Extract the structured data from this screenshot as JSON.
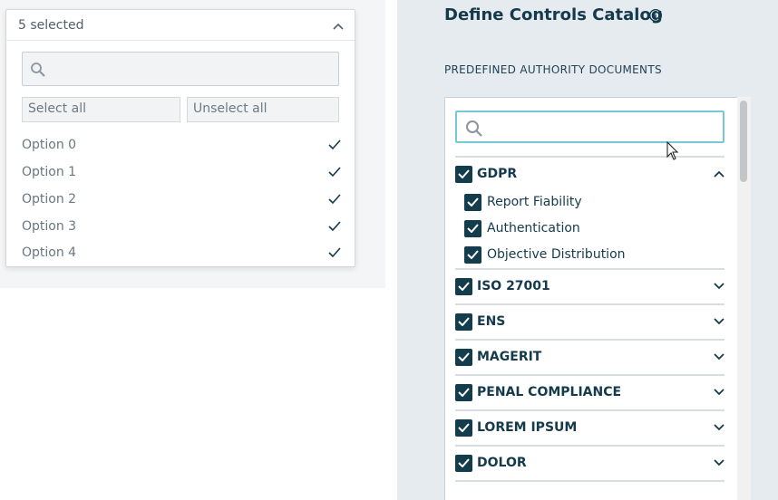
{
  "dropdown": {
    "selected_text": "5 selected",
    "search_placeholder": "",
    "select_all_label": "Select all",
    "unselect_all_label": "Unselect all",
    "options": [
      {
        "label": "Option 0",
        "checked": true
      },
      {
        "label": "Option 1",
        "checked": true
      },
      {
        "label": "Option 2",
        "checked": true
      },
      {
        "label": "Option 3",
        "checked": true
      },
      {
        "label": "Option 4",
        "checked": true
      }
    ]
  },
  "panel": {
    "title": "Define Controls Catalog",
    "section_label": "PREDEFINED AUTHORITY DOCUMENTS",
    "search_placeholder": "",
    "groups": [
      {
        "label": "GDPR",
        "checked": true,
        "expanded": true,
        "children": [
          {
            "label": "Report Fiability",
            "checked": true
          },
          {
            "label": "Authentication",
            "checked": true
          },
          {
            "label": "Objective Distribution",
            "checked": true
          }
        ]
      },
      {
        "label": "ISO 27001",
        "checked": true,
        "expanded": false
      },
      {
        "label": "ENS",
        "checked": true,
        "expanded": false
      },
      {
        "label": "MAGERIT",
        "checked": true,
        "expanded": false
      },
      {
        "label": "PENAL COMPLIANCE",
        "checked": true,
        "expanded": false
      },
      {
        "label": "LOREM IPSUM",
        "checked": true,
        "expanded": false
      },
      {
        "label": "DOLOR",
        "checked": true,
        "expanded": false
      }
    ]
  },
  "colors": {
    "accent_dark": "#133c4c",
    "search_focus": "#75c9d4",
    "panel_bg": "#e6ebf0"
  }
}
